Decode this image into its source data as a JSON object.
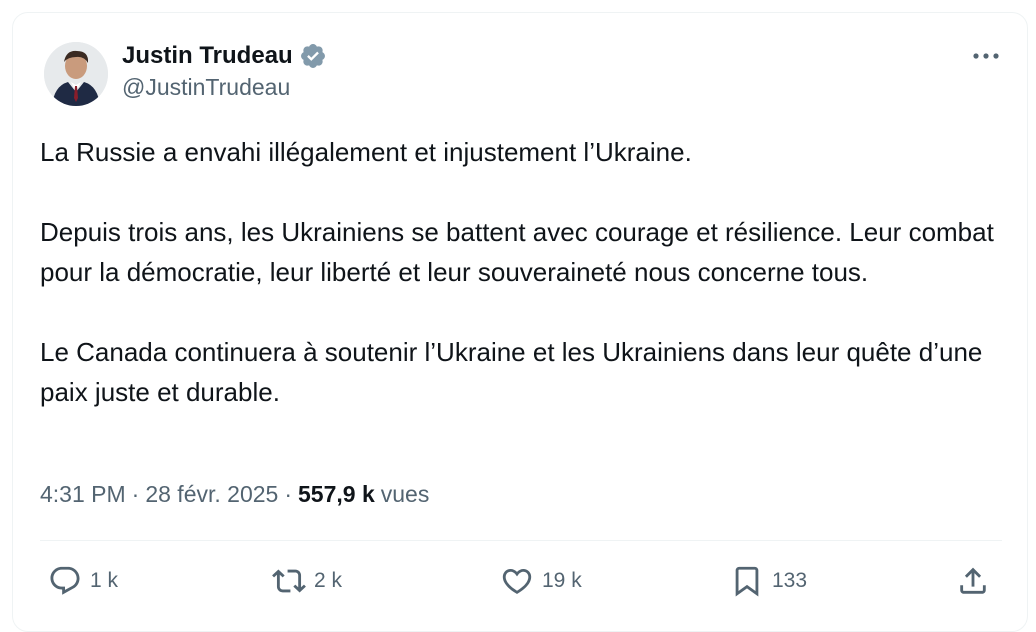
{
  "author": {
    "name": "Justin Trudeau",
    "handle": "@JustinTrudeau",
    "verified": true,
    "verified_color": "#829aab"
  },
  "tweet": {
    "paragraphs": [
      "La Russie a envahi illégalement et injustement l’Ukraine.",
      "Depuis trois ans, les Ukrainiens se battent avec courage et résilience. Leur combat pour la démocratie, leur liberté et leur souveraineté nous concerne tous.",
      "Le Canada continuera à soutenir l’Ukraine et les Ukrainiens dans leur quête d’une paix juste et durable."
    ]
  },
  "meta": {
    "time": "4:31 PM",
    "separator": "·",
    "date": "28 févr. 2025",
    "views_count": "557,9 k",
    "views_label": "vues"
  },
  "actions": {
    "reply_count": "1 k",
    "retweet_count": "2 k",
    "like_count": "19 k",
    "bookmark_count": "133"
  },
  "icons": {
    "more": "more-icon",
    "reply": "reply-icon",
    "retweet": "retweet-icon",
    "like": "heart-icon",
    "bookmark": "bookmark-icon",
    "share": "share-icon"
  }
}
